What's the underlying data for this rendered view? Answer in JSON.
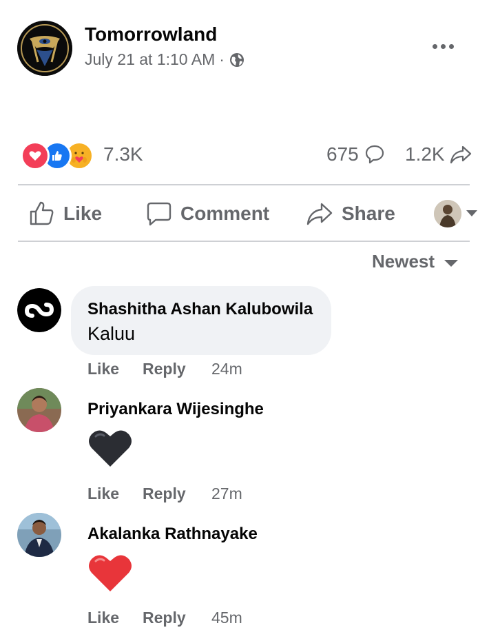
{
  "post": {
    "author": "Tomorrowland",
    "timestamp": "July 21 at 1:10 AM",
    "separator": "·",
    "privacy_icon": "globe-icon",
    "more_icon": "more-horizontal-icon"
  },
  "stats": {
    "reactions": [
      "love",
      "like",
      "care"
    ],
    "reaction_count": "7.3K",
    "comment_count": "675",
    "share_count": "1.2K"
  },
  "actions": {
    "like": "Like",
    "comment": "Comment",
    "share": "Share"
  },
  "sort": {
    "label": "Newest"
  },
  "comments": [
    {
      "name": "Shashitha Ashan Kalubowila",
      "text": "Kaluu",
      "like": "Like",
      "reply": "Reply",
      "time": "24m"
    },
    {
      "name": "Priyankara Wijesinghe",
      "emoji": "black-heart",
      "like": "Like",
      "reply": "Reply",
      "time": "27m"
    },
    {
      "name": "Akalanka Rathnayake",
      "emoji": "red-heart",
      "like": "Like",
      "reply": "Reply",
      "time": "45m"
    }
  ],
  "colors": {
    "like_blue": "#1877f2",
    "love_red": "#f33e58",
    "care_yellow": "#f7b125",
    "secondary_text": "#65676b",
    "bubble_bg": "#f0f2f5"
  }
}
